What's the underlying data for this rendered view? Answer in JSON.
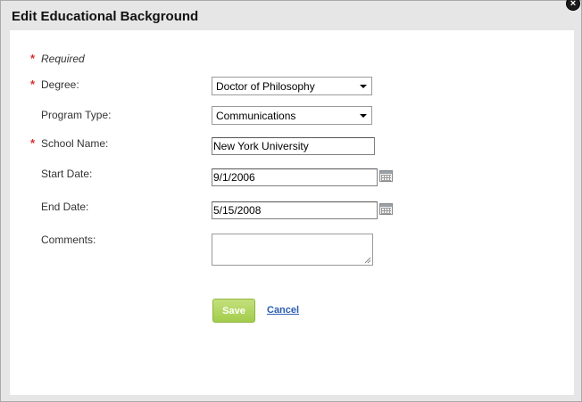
{
  "dialog": {
    "title": "Edit Educational Background",
    "close_glyph": "×"
  },
  "form": {
    "required_star": "*",
    "required_note": "Required",
    "degree": {
      "label": "Degree:",
      "value": "Doctor of Philosophy"
    },
    "program_type": {
      "label": "Program Type:",
      "value": "Communications"
    },
    "school_name": {
      "label": "School Name:",
      "value": "New York University"
    },
    "start_date": {
      "label": "Start Date:",
      "value": "9/1/2006"
    },
    "end_date": {
      "label": "End Date:",
      "value": "5/15/2008"
    },
    "comments": {
      "label": "Comments:",
      "value": ""
    }
  },
  "actions": {
    "save_label": "Save",
    "cancel_label": "Cancel"
  },
  "colors": {
    "required": "#d9302c",
    "save_button": "#a3cc4c",
    "link": "#2a5db0"
  }
}
